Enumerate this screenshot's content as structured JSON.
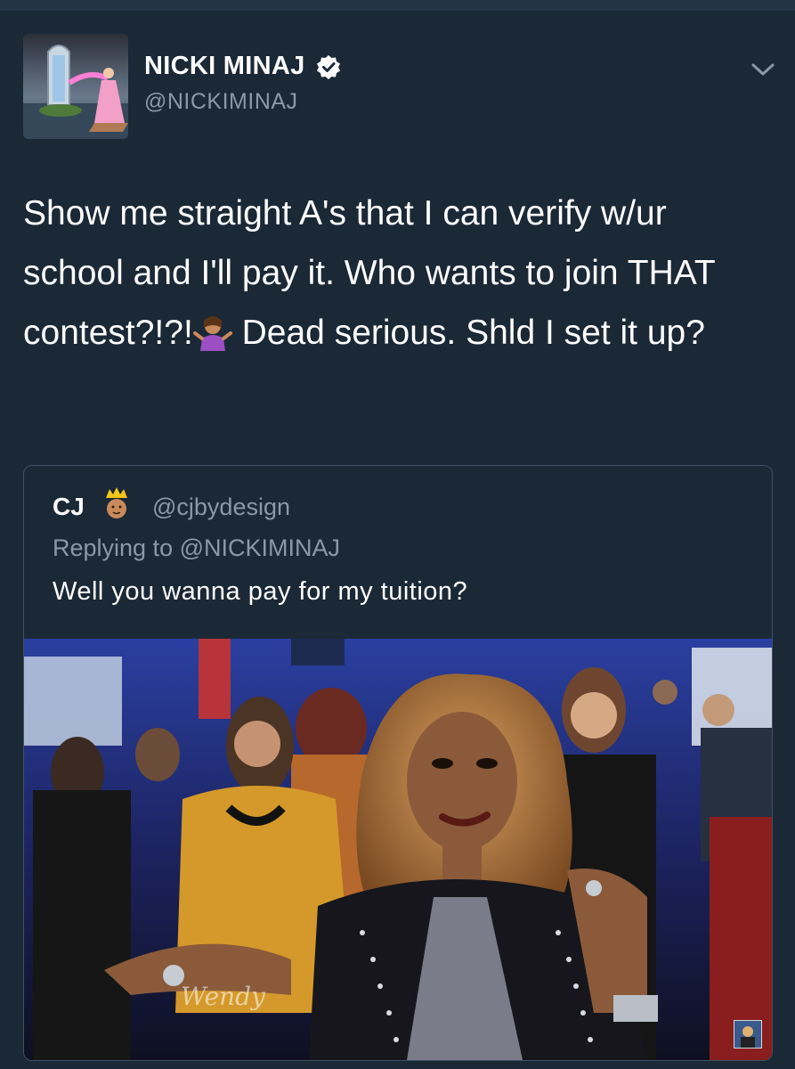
{
  "author": {
    "name": "NICKI MINAJ",
    "handle": "@NICKIMINAJ",
    "verified": true,
    "avatar_icon": "avatar-image"
  },
  "tweet": {
    "text_part1": "Show me straight A's that I can verify w/ur school and I'll pay it. Who wants to join THAT contest?!?!",
    "emoji": "person-shrugging-emoji",
    "text_part2": " Dead serious. Shld I set it up?"
  },
  "quoted": {
    "name": "CJ",
    "name_emoji": "crown-person-emoji",
    "handle": "@cjbydesign",
    "replying_to": "Replying to @NICKIMINAJ",
    "text": "Well you wanna pay for my tuition?",
    "media_watermark": "Wendy"
  },
  "colors": {
    "background": "#1b2836",
    "secondary_text": "#8b99a6",
    "border": "#3d5166",
    "verified_blue": "#1da1f2"
  }
}
